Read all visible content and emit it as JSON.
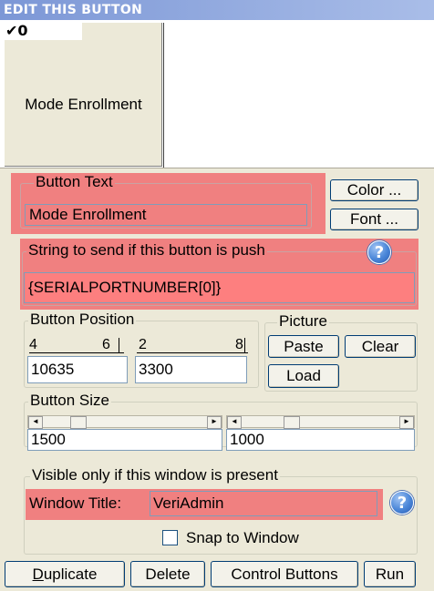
{
  "window": {
    "title": "EDIT THIS BUTTON"
  },
  "preview": {
    "index": "0",
    "checked": true,
    "button_label": "Mode Enrollment"
  },
  "button_text": {
    "legend": "Button Text",
    "value": "Mode Enrollment",
    "color_label": "Color ...",
    "font_label": "Font ..."
  },
  "send_string": {
    "legend": "String to send if this button is push",
    "value": "{SERIALPORTNUMBER[0]}",
    "help_icon": "question-icon"
  },
  "position": {
    "legend": "Button Position",
    "x_ticks": [
      "4",
      "6"
    ],
    "y_ticks": [
      "2",
      "8"
    ],
    "x_value": "10635",
    "y_value": "3300"
  },
  "picture": {
    "legend": "Picture",
    "paste_label": "Paste",
    "clear_label": "Clear",
    "load_label": "Load"
  },
  "size": {
    "legend": "Button Size",
    "width_value": "1500",
    "height_value": "1000"
  },
  "visibility": {
    "legend": "Visible only if this window is present",
    "window_title_label": "Window Title:",
    "window_title_value": "VeriAdmin",
    "snap_label": "Snap to Window",
    "snap_checked": false
  },
  "actions": {
    "duplicate": "Duplicate",
    "delete": "Delete",
    "control_buttons": "Control Buttons",
    "run": "Run"
  },
  "colors": {
    "highlight": "#f08080",
    "field_red": "#fd7f7f",
    "title_gradient": "#7c97d6"
  }
}
